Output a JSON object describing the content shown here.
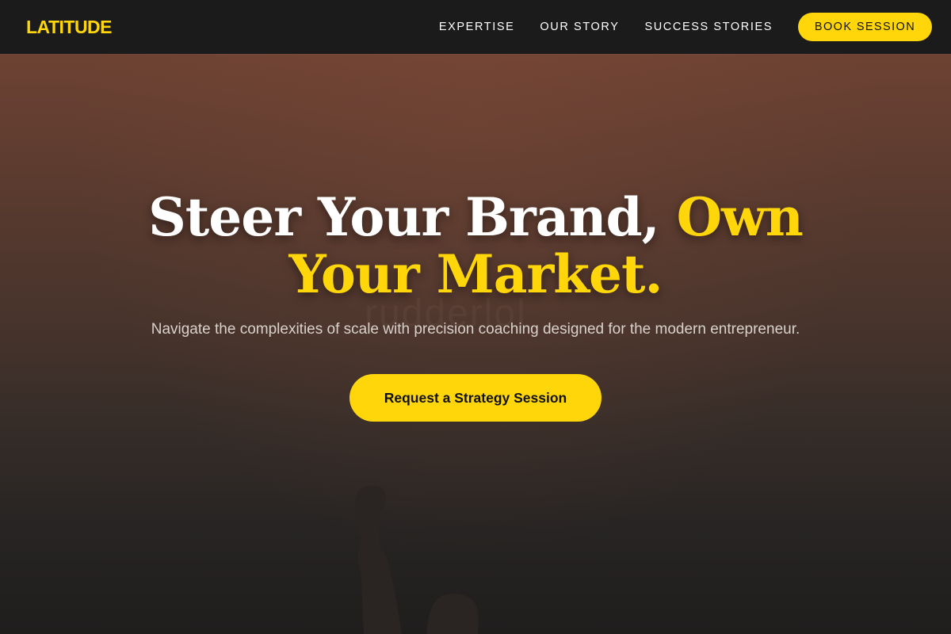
{
  "brand": {
    "logo": "LATITUDE"
  },
  "nav": {
    "links": [
      "EXPERTISE",
      "OUR STORY",
      "SUCCESS STORIES"
    ],
    "cta_label": "BOOK SESSION"
  },
  "hero": {
    "headline_part1": "Steer Your Brand, ",
    "headline_accent": "Own Your Market.",
    "subtext": "Navigate the complexities of scale with precision coaching designed for the modern entrepreneur.",
    "cta_label": "Request a Strategy Session",
    "watermark": "rudderlol"
  },
  "colors": {
    "accent": "#ffd60a",
    "nav_background": "#1b1b1b",
    "hero_top": "#6d4233",
    "hero_bottom": "#1f1e1d"
  },
  "icons": {
    "hero_figure": "raised-fist-silhouette"
  }
}
